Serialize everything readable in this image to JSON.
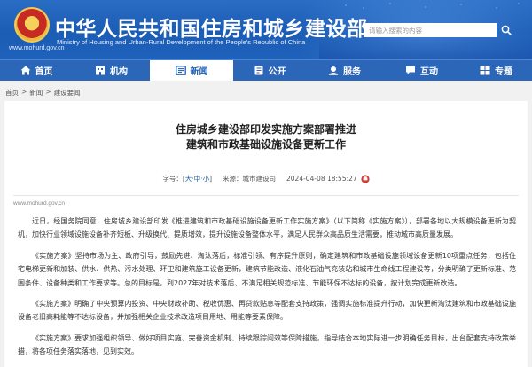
{
  "header": {
    "title_cn": "中华人民共和国住房和城乡建设部",
    "title_en": "Ministry of Housing and Urban-Rural Development of the People's Republic of China",
    "site": "www.mohurd.gov.cn",
    "search_placeholder": "请输入搜索的内容",
    "brand_color": "#1b5cb4",
    "emblem_colors": [
      "#c62a22",
      "#f6d25b"
    ]
  },
  "nav": {
    "items": [
      {
        "label": "首页",
        "icon": "home-icon"
      },
      {
        "label": "机构",
        "icon": "building-icon"
      },
      {
        "label": "新闻",
        "icon": "news-icon",
        "active": true
      },
      {
        "label": "公开",
        "icon": "disclosure-icon"
      },
      {
        "label": "服务",
        "icon": "service-icon"
      },
      {
        "label": "互动",
        "icon": "chat-icon"
      },
      {
        "label": "专题",
        "icon": "topic-icon"
      }
    ]
  },
  "breadcrumb": {
    "home": "首页",
    "sep": ">",
    "news": "新闻",
    "current": "建设要闻"
  },
  "article": {
    "title_line1": "住房城乡建设部印发实施方案部署推进",
    "title_line2": "建筑和市政基础设施设备更新工作",
    "font_prefix": "字号：",
    "font_open": "[",
    "font_large": "大",
    "font_mid": "中",
    "font_small": "小",
    "font_close": "]",
    "dot": "·",
    "source_label": "来源：",
    "source": "城市建设司",
    "date": "2024-04-08 18:55:27",
    "source_url": "www.mohurd.gov.cn",
    "paragraphs": [
      "近日，经国务院同意，住房城乡建设部印发《推进建筑和市政基础设施设备更新工作实施方案》（以下简称《实施方案》），部署各地以大规模设备更新为契机，加快行业领域设施设备补齐短板、升级换代、提质增效，提升设施设备整体水平，满足人民群众高品质生活需要，推动城市高质量发展。",
      "《实施方案》坚持市场为主、政府引导，鼓励先进、淘汰落后，标准引领、有序提升原则，确定建筑和市政基础设施领域设备更新10项重点任务，包括住宅电梯更新和加装、供水、供热、污水处理、环卫和建筑施工设备更新，建筑节能改造、液化石油气充装站和城市生命线工程建设等，分类明确了更新标准、范围条件、设备种类和工作要求等。总的目标是，到2027年对技术落后、不满足相关规范标准、节能环保不达标的设备，按计划完成更新改造。",
      "《实施方案》明确了中央预算内投资、中央财政补助、税收优惠、再贷款贴息等配套支持政策，强调实施标准提升行动，加快更新淘汰建筑和市政基础设施设备老旧高耗能等不达标设备，并加强相关企业技术改造项目用地、用能等要素保障。",
      "《实施方案》要求加强组织领导、做好项目实施、完善资金机制、持续跟踪问效等保障措施，指导结合本地实际进一步明确任务目标，出台配套支持政策举措，将各项任务落实落地，见到实效。"
    ]
  }
}
